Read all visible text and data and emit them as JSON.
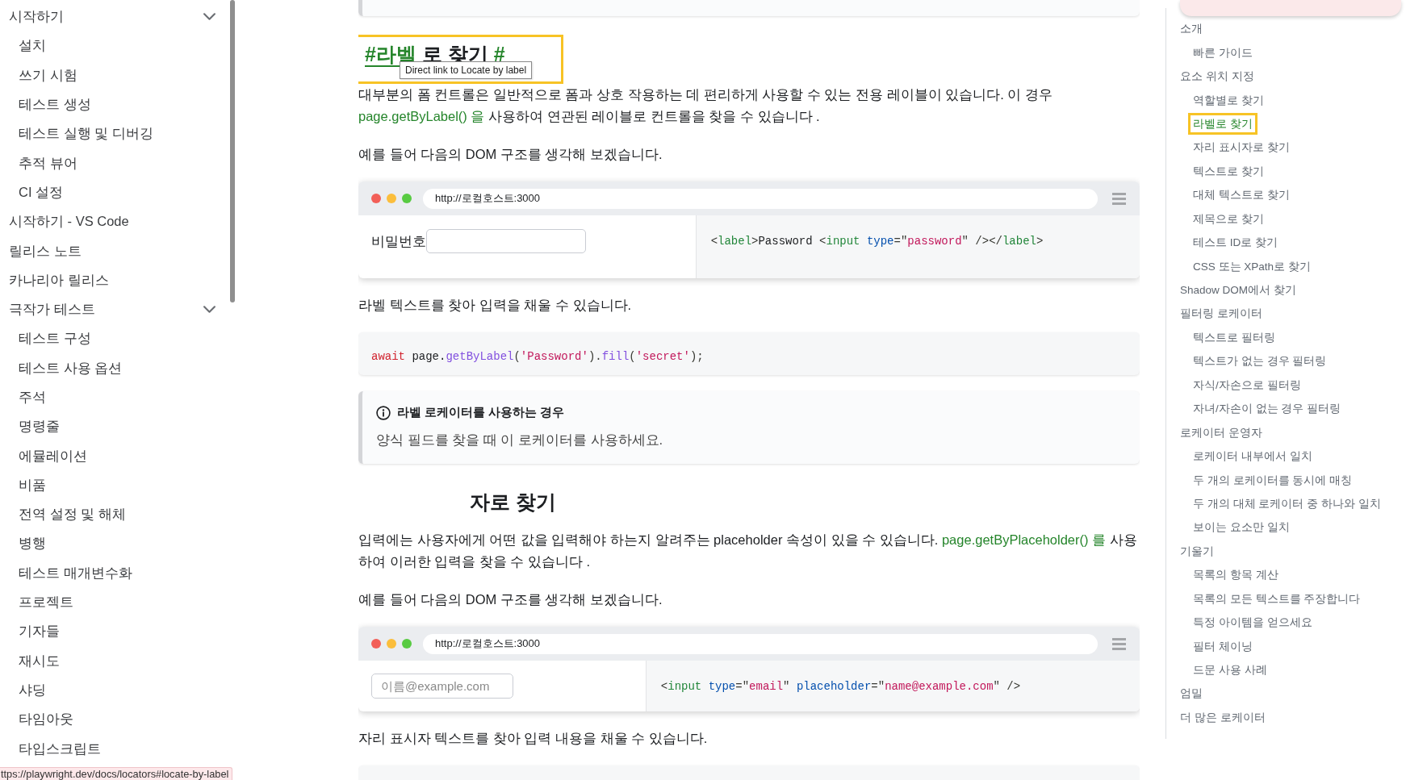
{
  "sidebar": {
    "items": [
      {
        "label": "시작하기",
        "expanded": true,
        "children": [
          {
            "label": "설치"
          },
          {
            "label": "쓰기 시험"
          },
          {
            "label": "테스트 생성"
          },
          {
            "label": "테스트 실행 및 디버깅"
          },
          {
            "label": "추적 뷰어"
          },
          {
            "label": "CI 설정"
          }
        ]
      },
      {
        "label": "시작하기 - VS Code"
      },
      {
        "label": "릴리스 노트"
      },
      {
        "label": "카나리아 릴리스"
      },
      {
        "label": "극작가 테스트",
        "expanded": true,
        "children": [
          {
            "label": "테스트 구성"
          },
          {
            "label": "테스트 사용 옵션"
          },
          {
            "label": "주석"
          },
          {
            "label": "명령줄"
          },
          {
            "label": "에뮬레이션"
          },
          {
            "label": "비품"
          },
          {
            "label": "전역 설정 및 해체"
          },
          {
            "label": "병행"
          },
          {
            "label": "테스트 매개변수화"
          },
          {
            "label": "프로젝트"
          },
          {
            "label": "기자들"
          },
          {
            "label": "재시도"
          },
          {
            "label": "샤딩"
          },
          {
            "label": "타임아웃"
          },
          {
            "label": "타입스크립트"
          }
        ]
      }
    ]
  },
  "article": {
    "blocks": [
      {
        "kind": "card_end"
      },
      {
        "kind": "heading",
        "link_text": "#라벨",
        "text": "로 찾기",
        "anchor": "#",
        "highlighted": true,
        "tooltip": "Direct link to Locate by label"
      },
      {
        "kind": "paragraph",
        "segments": [
          {
            "kind": "text",
            "text": "대부분의 폼 컨트롤은 일반적으로 폼과 상호 작용하는 데 편리하게 사용할 수 있는 전용 레이블이 있습니다. 이 경우 "
          },
          {
            "kind": "link",
            "text": "page.getByLabel() 을"
          },
          {
            "kind": "text",
            "text": " 사용하여 연관된 레이블로 컨트롤을 찾을 수 있습니다 ."
          }
        ]
      },
      {
        "kind": "paragraph",
        "segments": [
          {
            "kind": "text",
            "text": "예를 들어 다음의 DOM 구조를 생각해 보겠습니다."
          }
        ]
      },
      {
        "kind": "demo",
        "url": "http://로컬호스트:3000",
        "field_label": "비밀번호",
        "code": [
          {
            "kind": "punct",
            "text": "<"
          },
          {
            "kind": "tag",
            "text": "label"
          },
          {
            "kind": "punct",
            "text": ">"
          },
          {
            "kind": "text",
            "text": "Password "
          },
          {
            "kind": "punct",
            "text": "<"
          },
          {
            "kind": "tag",
            "text": "input"
          },
          {
            "kind": "attr",
            "text": " type"
          },
          {
            "kind": "punct",
            "text": "=\""
          },
          {
            "kind": "string",
            "text": "password"
          },
          {
            "kind": "punct",
            "text": "\" />"
          },
          {
            "kind": "punct",
            "text": "</"
          },
          {
            "kind": "tag",
            "text": "label"
          },
          {
            "kind": "punct",
            "text": ">"
          }
        ]
      },
      {
        "kind": "paragraph",
        "segments": [
          {
            "kind": "text",
            "text": "라벨 텍스트를 찾아 입력을 채울 수 있습니다."
          }
        ]
      },
      {
        "kind": "code",
        "tokens": [
          {
            "kind": "keyword",
            "text": "await"
          },
          {
            "kind": "text",
            "text": " page."
          },
          {
            "kind": "func",
            "text": "getByLabel"
          },
          {
            "kind": "punct",
            "text": "("
          },
          {
            "kind": "string",
            "text": "'Password'"
          },
          {
            "kind": "punct",
            "text": ")."
          },
          {
            "kind": "func",
            "text": "fill"
          },
          {
            "kind": "punct",
            "text": "("
          },
          {
            "kind": "string",
            "text": "'secret'"
          },
          {
            "kind": "punct",
            "text": ");"
          }
        ]
      },
      {
        "kind": "info",
        "title": "라벨 로케이터를 사용하는 경우",
        "body": "양식 필드를 찾을 때 이 로케이터를 사용하세요."
      },
      {
        "kind": "heading",
        "text": "자로 찾기",
        "highlighted": false
      },
      {
        "kind": "paragraph",
        "segments": [
          {
            "kind": "text",
            "text": "입력에는 사용자에게 어떤 값을 입력해야 하는지 알려주는 placeholder 속성이 있을 수 있습니다. "
          },
          {
            "kind": "link",
            "text": "page.getByPlaceholder() 를"
          },
          {
            "kind": "text",
            "text": " 사용하여 이러한 입력을 찾을 수 있습니다 ."
          }
        ]
      },
      {
        "kind": "paragraph",
        "segments": [
          {
            "kind": "text",
            "text": "예를 들어 다음의 DOM 구조를 생각해 보겠습니다."
          }
        ]
      },
      {
        "kind": "demo",
        "url": "http://로컬호스트:3000",
        "placeholder": "이름@example.com",
        "code": [
          {
            "kind": "punct",
            "text": "<"
          },
          {
            "kind": "tag",
            "text": "input"
          },
          {
            "kind": "attr",
            "text": " type"
          },
          {
            "kind": "punct",
            "text": "=\""
          },
          {
            "kind": "string",
            "text": "email"
          },
          {
            "kind": "punct",
            "text": "\""
          },
          {
            "kind": "attr",
            "text": " placeholder"
          },
          {
            "kind": "punct",
            "text": "=\""
          },
          {
            "kind": "string",
            "text": "name@example.com"
          },
          {
            "kind": "punct",
            "text": "\" />"
          }
        ]
      },
      {
        "kind": "paragraph",
        "segments": [
          {
            "kind": "text",
            "text": "자리 표시자 텍스트를 찾아 입력 내용을 채울 수 있습니다."
          }
        ]
      },
      {
        "kind": "code"
      }
    ]
  },
  "toc": {
    "items": [
      {
        "label": "소개",
        "selected": false,
        "children": [
          {
            "label": "빠른 가이드",
            "selected": false
          }
        ]
      },
      {
        "label": "요소 위치 지정",
        "selected": false,
        "children": [
          {
            "label": "역할별로 찾기",
            "selected": false
          },
          {
            "label": "라벨로 찾기",
            "selected": true
          },
          {
            "label": "자리 표시자로 찾기",
            "selected": false
          },
          {
            "label": "텍스트로 찾기",
            "selected": false
          },
          {
            "label": "대체 텍스트로 찾기",
            "selected": false
          },
          {
            "label": "제목으로 찾기",
            "selected": false
          },
          {
            "label": "테스트 ID로 찾기",
            "selected": false
          },
          {
            "label": "CSS 또는 XPath로 찾기",
            "selected": false
          }
        ]
      },
      {
        "label": "Shadow DOM에서 찾기",
        "selected": false
      },
      {
        "label": "필터링 로케이터",
        "selected": false,
        "children": [
          {
            "label": "텍스트로 필터링",
            "selected": false
          },
          {
            "label": "텍스트가 없는 경우 필터링",
            "selected": false
          },
          {
            "label": "자식/자손으로 필터링",
            "selected": false
          },
          {
            "label": "자녀/자손이 없는 경우 필터링",
            "selected": false
          }
        ]
      },
      {
        "label": "로케이터 운영자",
        "selected": false,
        "children": [
          {
            "label": "로케이터 내부에서 일치",
            "selected": false
          },
          {
            "label": "두 개의 로케이터를 동시에 매칭",
            "selected": false
          },
          {
            "label": "두 개의 대체 로케이터 중 하나와 일치",
            "selected": false
          },
          {
            "label": "보이는 요소만 일치",
            "selected": false
          }
        ]
      },
      {
        "label": "기울기",
        "selected": false,
        "children": [
          {
            "label": "목록의 항목 계산",
            "selected": false
          },
          {
            "label": "목록의 모든 텍스트를 주장합니다",
            "selected": false
          },
          {
            "label": "특정 아이템을 얻으세요",
            "selected": false
          },
          {
            "label": "필터 체이닝",
            "selected": false
          },
          {
            "label": "드문 사용 사례",
            "selected": false
          }
        ]
      },
      {
        "label": "엄밀",
        "selected": false
      },
      {
        "label": "더 많은 로케이터",
        "selected": false
      }
    ]
  },
  "status_bar": {
    "url": "ttps://playwright.dev/docs/locators#locate-by-label"
  }
}
